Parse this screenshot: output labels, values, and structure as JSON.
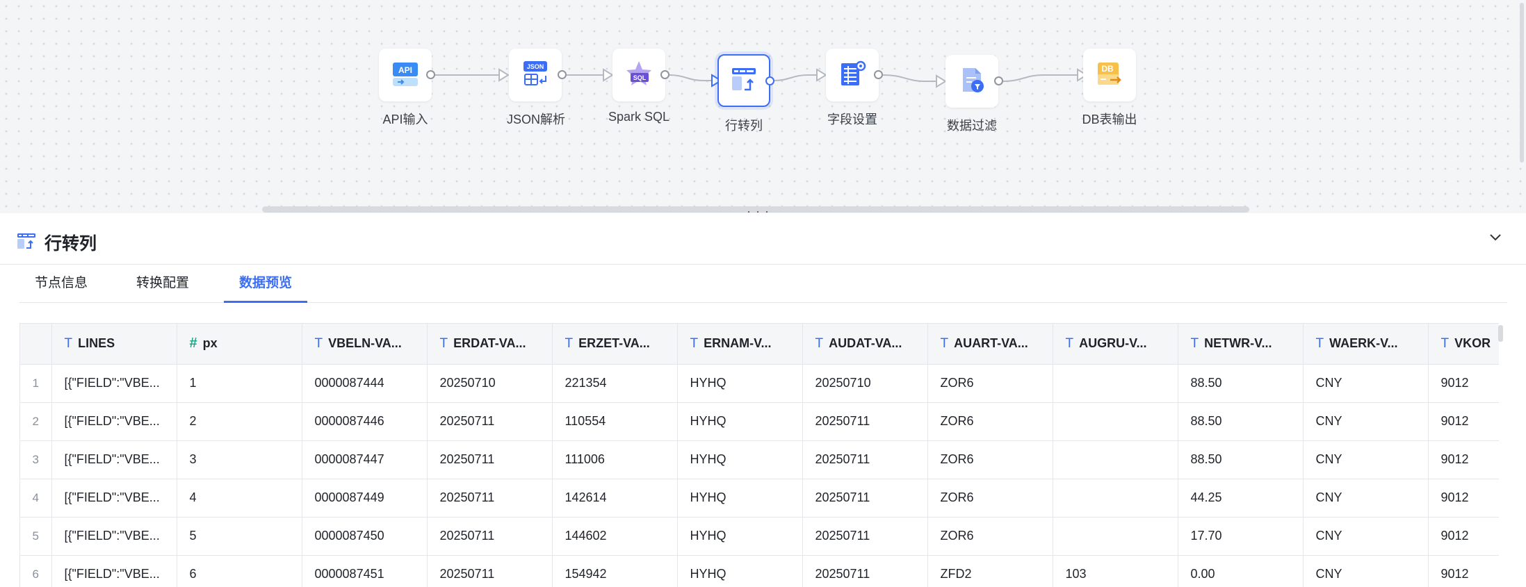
{
  "pipeline": {
    "nodes": [
      {
        "label": "API输入",
        "icon": "api-input-icon"
      },
      {
        "label": "JSON解析",
        "icon": "json-parse-icon"
      },
      {
        "label": "Spark SQL",
        "icon": "spark-sql-icon"
      },
      {
        "label": "行转列",
        "icon": "row-to-column-icon",
        "selected": true
      },
      {
        "label": "字段设置",
        "icon": "field-settings-icon"
      },
      {
        "label": "数据过滤",
        "icon": "data-filter-icon"
      },
      {
        "label": "DB表输出",
        "icon": "db-output-icon"
      }
    ],
    "colors": {
      "accent": "#3b6ef5",
      "edge": "#b4b9c2"
    }
  },
  "panel": {
    "title": "行转列",
    "tabs": [
      {
        "label": "节点信息"
      },
      {
        "label": "转换配置"
      },
      {
        "label": "数据预览",
        "active": true
      }
    ]
  },
  "table": {
    "columns": [
      {
        "name": "LINES",
        "type": "text"
      },
      {
        "name": "px",
        "type": "number"
      },
      {
        "name": "VBELN-VA...",
        "type": "text"
      },
      {
        "name": "ERDAT-VA...",
        "type": "text"
      },
      {
        "name": "ERZET-VA...",
        "type": "text"
      },
      {
        "name": "ERNAM-V...",
        "type": "text"
      },
      {
        "name": "AUDAT-VA...",
        "type": "text"
      },
      {
        "name": "AUART-VA...",
        "type": "text"
      },
      {
        "name": "AUGRU-V...",
        "type": "text"
      },
      {
        "name": "NETWR-V...",
        "type": "text"
      },
      {
        "name": "WAERK-V...",
        "type": "text"
      },
      {
        "name": "VKOR",
        "type": "text"
      }
    ],
    "rows": [
      {
        "index": "1",
        "cells": [
          "[{\"FIELD\":\"VBE...",
          "1",
          "0000087444",
          "20250710",
          "221354",
          "HYHQ",
          "20250710",
          "ZOR6",
          "",
          "88.50",
          "CNY",
          "9012"
        ]
      },
      {
        "index": "2",
        "cells": [
          "[{\"FIELD\":\"VBE...",
          "2",
          "0000087446",
          "20250711",
          "110554",
          "HYHQ",
          "20250711",
          "ZOR6",
          "",
          "88.50",
          "CNY",
          "9012"
        ]
      },
      {
        "index": "3",
        "cells": [
          "[{\"FIELD\":\"VBE...",
          "3",
          "0000087447",
          "20250711",
          "111006",
          "HYHQ",
          "20250711",
          "ZOR6",
          "",
          "88.50",
          "CNY",
          "9012"
        ]
      },
      {
        "index": "4",
        "cells": [
          "[{\"FIELD\":\"VBE...",
          "4",
          "0000087449",
          "20250711",
          "142614",
          "HYHQ",
          "20250711",
          "ZOR6",
          "",
          "44.25",
          "CNY",
          "9012"
        ]
      },
      {
        "index": "5",
        "cells": [
          "[{\"FIELD\":\"VBE...",
          "5",
          "0000087450",
          "20250711",
          "144602",
          "HYHQ",
          "20250711",
          "ZOR6",
          "",
          "17.70",
          "CNY",
          "9012"
        ]
      },
      {
        "index": "6",
        "cells": [
          "[{\"FIELD\":\"VBE...",
          "6",
          "0000087451",
          "20250711",
          "154942",
          "HYHQ",
          "20250711",
          "ZFD2",
          "103",
          "0.00",
          "CNY",
          "9012"
        ]
      }
    ]
  }
}
